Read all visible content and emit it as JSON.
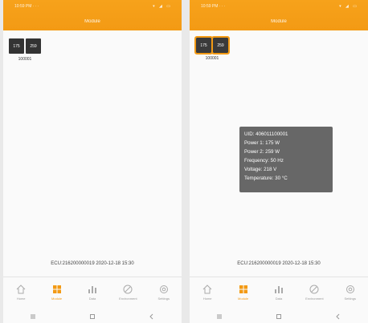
{
  "left": {
    "status_left": "10:59 PM · · ·",
    "status_right": "▾ ◢ ▭",
    "title": "Module",
    "modules": [
      {
        "label": "175"
      },
      {
        "label": "259"
      }
    ],
    "module_id": "100001",
    "ecu_line": "ECU:216200000019  2020-12-18 15:30",
    "tabs": [
      {
        "label": "Home",
        "icon": "home-icon"
      },
      {
        "label": "Module",
        "icon": "grid-icon",
        "active": true
      },
      {
        "label": "Data",
        "icon": "bar-chart-icon"
      },
      {
        "label": "Environment",
        "icon": "leaf-icon"
      },
      {
        "label": "Settings",
        "icon": "gear-icon"
      }
    ]
  },
  "right": {
    "status_left": "10:59 PM · · ·",
    "status_right": "▾ ◢ ▭",
    "title": "Module",
    "modules": [
      {
        "label": "175"
      },
      {
        "label": "259"
      }
    ],
    "module_id": "100001",
    "tooltip": {
      "uid": "UID: 406011100001",
      "power1": "Power 1: 175 W",
      "power2": "Power 2: 259 W",
      "frequency": "Frequency: 50 Hz",
      "voltage": "Voltage: 218 V",
      "temperature": "Temperature: 30 °C"
    },
    "ecu_line": "ECU:216200000019  2020-12-18 15:30",
    "tabs": [
      {
        "label": "Home",
        "icon": "home-icon"
      },
      {
        "label": "Module",
        "icon": "grid-icon",
        "active": true
      },
      {
        "label": "Data",
        "icon": "bar-chart-icon"
      },
      {
        "label": "Environment",
        "icon": "leaf-icon"
      },
      {
        "label": "Settings",
        "icon": "gear-icon"
      }
    ]
  },
  "colors": {
    "accent": "#f39a14",
    "module_bg": "#333333",
    "tooltip_bg": "#5a5a5a"
  }
}
